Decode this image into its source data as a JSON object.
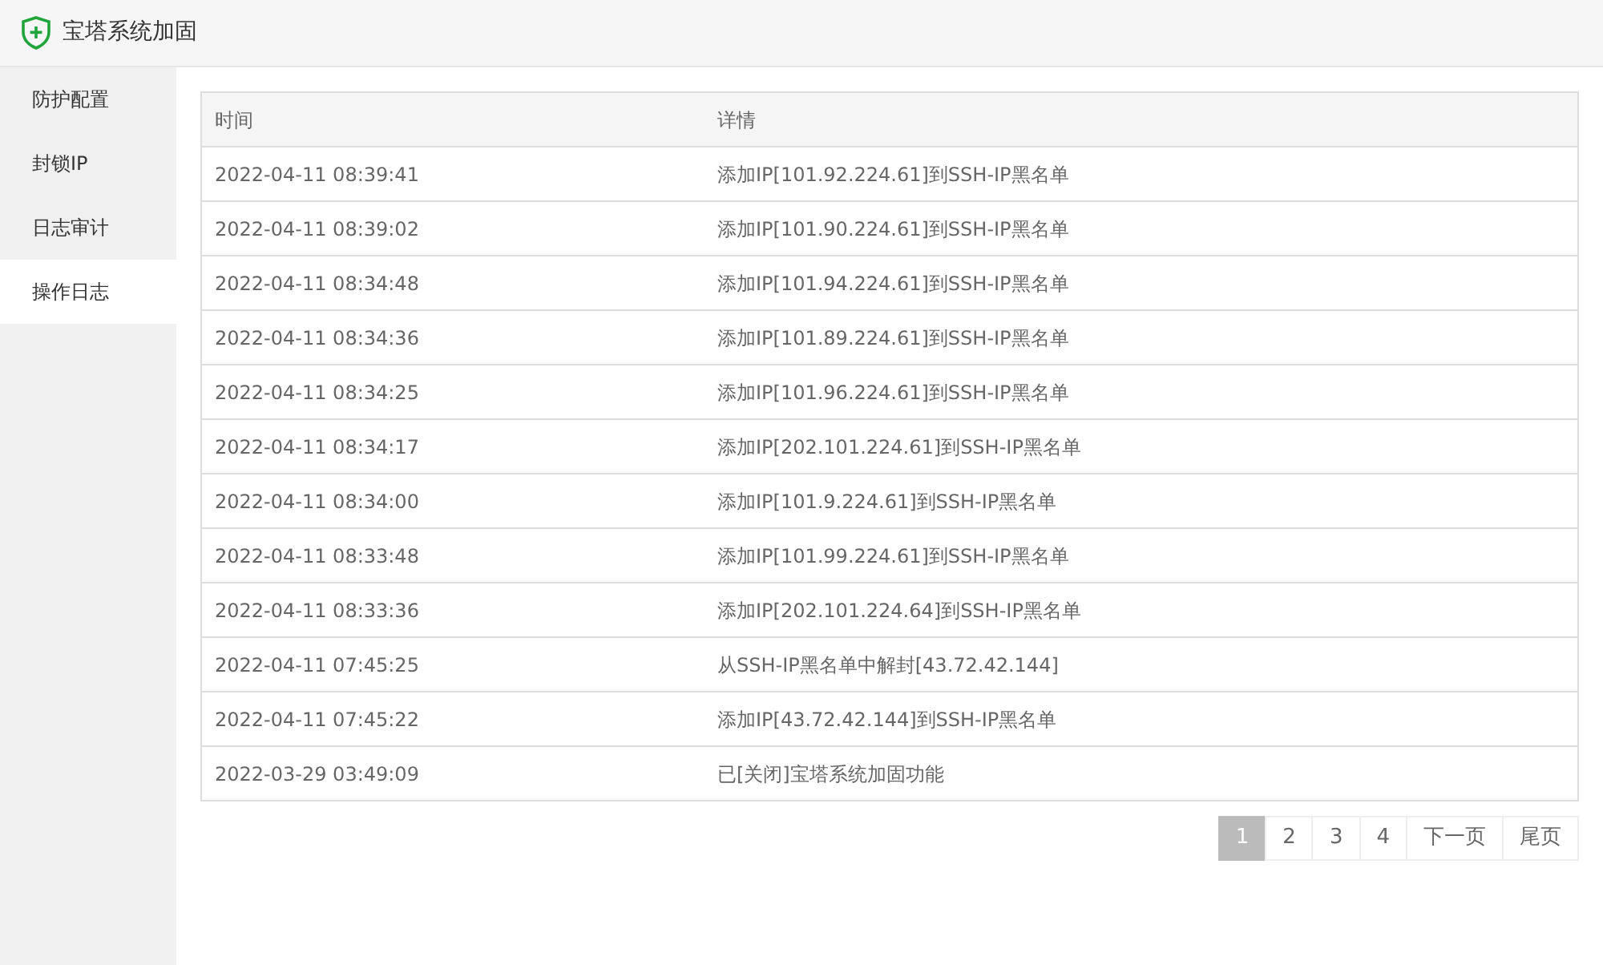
{
  "window": {
    "title": "宝塔系统加固"
  },
  "sidebar": {
    "items": [
      {
        "label": "防护配置",
        "selected": false
      },
      {
        "label": "封锁IP",
        "selected": false
      },
      {
        "label": "日志审计",
        "selected": false
      },
      {
        "label": "操作日志",
        "selected": true
      }
    ]
  },
  "table": {
    "columns": [
      "时间",
      "详情"
    ],
    "rows": [
      [
        "2022-04-11 08:39:41",
        "添加IP[101.92.224.61]到SSH-IP黑名单"
      ],
      [
        "2022-04-11 08:39:02",
        "添加IP[101.90.224.61]到SSH-IP黑名单"
      ],
      [
        "2022-04-11 08:34:48",
        "添加IP[101.94.224.61]到SSH-IP黑名单"
      ],
      [
        "2022-04-11 08:34:36",
        "添加IP[101.89.224.61]到SSH-IP黑名单"
      ],
      [
        "2022-04-11 08:34:25",
        "添加IP[101.96.224.61]到SSH-IP黑名单"
      ],
      [
        "2022-04-11 08:34:17",
        "添加IP[202.101.224.61]到SSH-IP黑名单"
      ],
      [
        "2022-04-11 08:34:00",
        "添加IP[101.9.224.61]到SSH-IP黑名单"
      ],
      [
        "2022-04-11 08:33:48",
        "添加IP[101.99.224.61]到SSH-IP黑名单"
      ],
      [
        "2022-04-11 08:33:36",
        "添加IP[202.101.224.64]到SSH-IP黑名单"
      ],
      [
        "2022-04-11 07:45:25",
        "从SSH-IP黑名单中解封[43.72.42.144]"
      ],
      [
        "2022-04-11 07:45:22",
        "添加IP[43.72.42.144]到SSH-IP黑名单"
      ],
      [
        "2022-03-29 03:49:09",
        "已[关闭]宝塔系统加固功能"
      ]
    ]
  },
  "pagination": [
    {
      "label": "1",
      "selected": true
    },
    {
      "label": "2",
      "selected": false
    },
    {
      "label": "3",
      "selected": false
    },
    {
      "label": "4",
      "selected": false
    },
    {
      "label": "下一页",
      "selected": false
    },
    {
      "label": "尾页",
      "selected": false
    }
  ]
}
